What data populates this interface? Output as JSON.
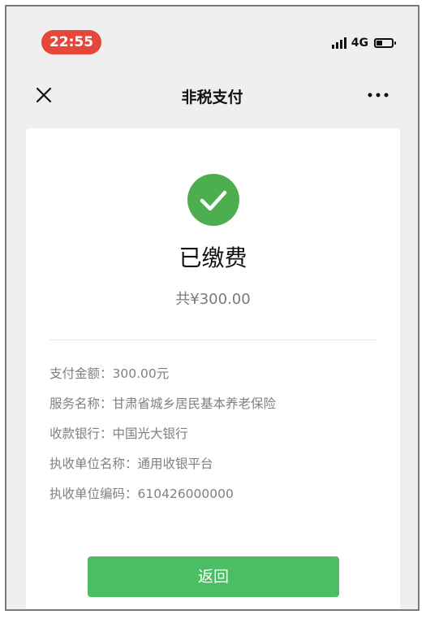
{
  "status_bar": {
    "time": "22:55",
    "network": "4G",
    "time_pill_color": "#e5483a"
  },
  "navbar": {
    "title": "非税支付",
    "close_icon": "close-icon",
    "more_icon": "more-icon"
  },
  "result": {
    "icon": "check-circle-icon",
    "icon_color": "#4cae4f",
    "title": "已缴费",
    "total": "共¥300.00"
  },
  "details": [
    {
      "label": "支付金额：",
      "value": "300.00元"
    },
    {
      "label": "服务名称：",
      "value": "甘肃省城乡居民基本养老保险"
    },
    {
      "label": "收款银行：",
      "value": "中国光大银行"
    },
    {
      "label": "执收单位名称：",
      "value": "通用收银平台"
    },
    {
      "label": "执收单位编码：",
      "value": "610426000000"
    }
  ],
  "actions": {
    "return_label": "返回",
    "button_color": "#4dbd63"
  }
}
